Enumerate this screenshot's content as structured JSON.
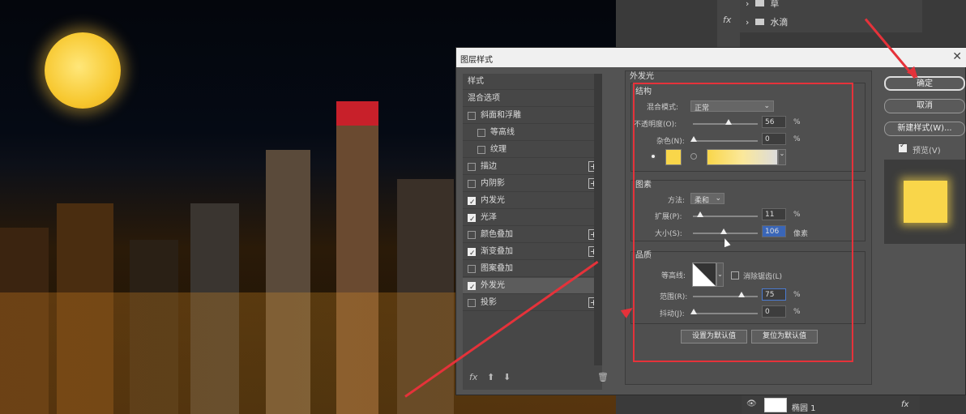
{
  "right_panel": {
    "layer_items": [
      {
        "label": "草"
      },
      {
        "label": "水滴"
      }
    ],
    "bottom_layer": {
      "name": "椭圆 1",
      "fx": "fx"
    }
  },
  "dialog": {
    "title": "图层样式",
    "style_list": [
      {
        "label": "样式",
        "checkbox": null,
        "plus": false,
        "selected": false,
        "indent": 0
      },
      {
        "label": "混合选项",
        "checkbox": null,
        "plus": false,
        "selected": false,
        "indent": 0
      },
      {
        "label": "斜面和浮雕",
        "checkbox": false,
        "plus": false,
        "selected": false,
        "indent": 0
      },
      {
        "label": "等高线",
        "checkbox": false,
        "plus": false,
        "selected": false,
        "indent": 1
      },
      {
        "label": "纹理",
        "checkbox": false,
        "plus": false,
        "selected": false,
        "indent": 1
      },
      {
        "label": "描边",
        "checkbox": false,
        "plus": true,
        "selected": false,
        "indent": 0
      },
      {
        "label": "内阴影",
        "checkbox": false,
        "plus": true,
        "selected": false,
        "indent": 0
      },
      {
        "label": "内发光",
        "checkbox": true,
        "plus": false,
        "selected": false,
        "indent": 0
      },
      {
        "label": "光泽",
        "checkbox": true,
        "plus": false,
        "selected": false,
        "indent": 0
      },
      {
        "label": "颜色叠加",
        "checkbox": false,
        "plus": true,
        "selected": false,
        "indent": 0
      },
      {
        "label": "渐变叠加",
        "checkbox": true,
        "plus": true,
        "selected": false,
        "indent": 0
      },
      {
        "label": "图案叠加",
        "checkbox": false,
        "plus": false,
        "selected": false,
        "indent": 0
      },
      {
        "label": "外发光",
        "checkbox": true,
        "plus": false,
        "selected": true,
        "indent": 0
      },
      {
        "label": "投影",
        "checkbox": false,
        "plus": true,
        "selected": false,
        "indent": 0
      }
    ],
    "footer": {
      "fx": "fx"
    },
    "panel_title": "外发光",
    "structure": {
      "title": "结构",
      "blend_mode_label": "混合模式:",
      "blend_mode_value": "正常",
      "opacity_label": "不透明度(O):",
      "opacity_value": "56",
      "noise_label": "杂色(N):",
      "noise_value": "0",
      "percent": "%",
      "color": "#f9d64a"
    },
    "elements": {
      "title": "图素",
      "method_label": "方法:",
      "method_value": "柔和",
      "spread_label": "扩展(P):",
      "spread_value": "11",
      "size_label": "大小(S):",
      "size_value": "106",
      "size_unit": "像素",
      "percent": "%"
    },
    "quality": {
      "title": "品质",
      "contour_label": "等高线:",
      "antialias_label": "消除锯齿(L)",
      "range_label": "范围(R):",
      "range_value": "75",
      "jitter_label": "抖动(J):",
      "jitter_value": "0",
      "percent": "%"
    },
    "make_default": "设置为默认值",
    "reset_default": "复位为默认值",
    "ok": "确定",
    "cancel": "取消",
    "new_style": "新建样式(W)...",
    "preview_label": "预览(V)",
    "accent": "#e5323a"
  }
}
